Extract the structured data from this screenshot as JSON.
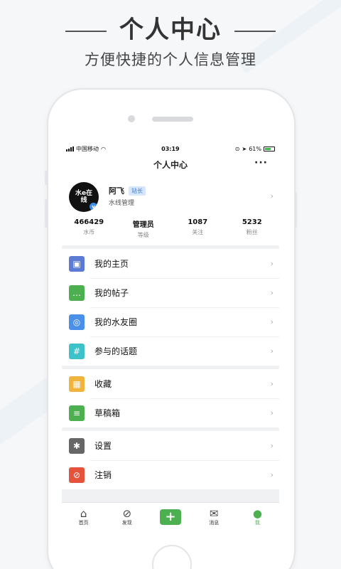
{
  "header": {
    "title": "个人中心",
    "subtitle": "方便快捷的个人信息管理"
  },
  "status": {
    "carrier": "中国移动",
    "time": "03:19",
    "battery": "61%"
  },
  "nav": {
    "title": "个人中心",
    "more": "···"
  },
  "profile": {
    "avatar_text": "水e在线",
    "name": "阿飞",
    "badge": "站长",
    "subtitle": "水线管理"
  },
  "stats": [
    {
      "value": "466429",
      "label": "水币"
    },
    {
      "value": "管理员",
      "label": "等级"
    },
    {
      "value": "1087",
      "label": "关注"
    },
    {
      "value": "5232",
      "label": "粉丝"
    }
  ],
  "menu_groups": [
    [
      {
        "label": "我的主页",
        "icon": "image-icon",
        "color": "#5b7bd5"
      },
      {
        "label": "我的帖子",
        "icon": "chat-icon",
        "color": "#4caf50"
      },
      {
        "label": "我的水友圈",
        "icon": "swirl-icon",
        "color": "#4a8fe8"
      },
      {
        "label": "参与的话题",
        "icon": "hash-icon",
        "color": "#3cc2c8"
      }
    ],
    [
      {
        "label": "收藏",
        "icon": "box-icon",
        "color": "#f0b33b"
      },
      {
        "label": "草稿箱",
        "icon": "note-icon",
        "color": "#4caf50"
      }
    ],
    [
      {
        "label": "设置",
        "icon": "gear-icon",
        "color": "#666666"
      },
      {
        "label": "注销",
        "icon": "ban-icon",
        "color": "#e5533d"
      }
    ]
  ],
  "tabs": [
    {
      "label": "首页",
      "icon": "home-icon"
    },
    {
      "label": "发现",
      "icon": "compass-icon"
    },
    {
      "label": "",
      "icon": "plus-icon"
    },
    {
      "label": "消息",
      "icon": "mail-icon"
    },
    {
      "label": "我",
      "icon": "person-icon"
    }
  ],
  "colors": {
    "accent": "#4caf50",
    "badge_bg": "#d6e6fb"
  }
}
